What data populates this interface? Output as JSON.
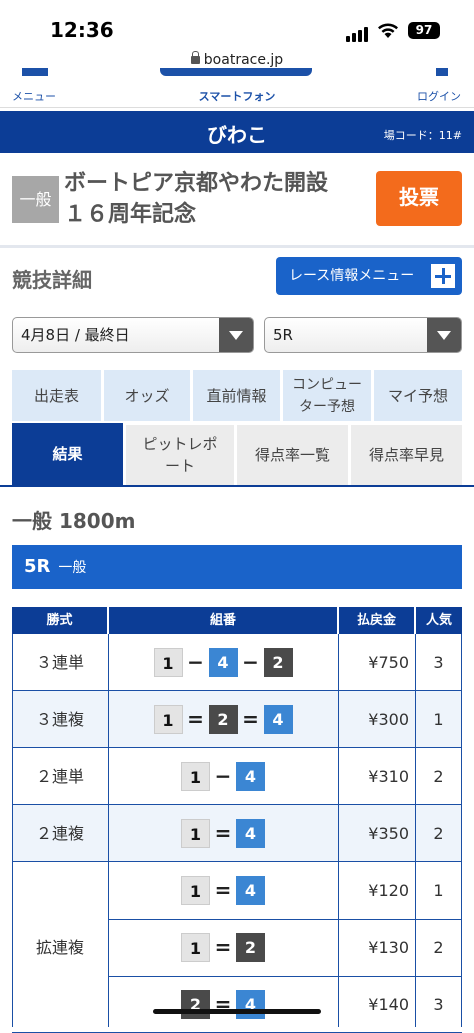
{
  "status_bar": {
    "time": "12:36",
    "battery": "97"
  },
  "browser": {
    "url": "boatrace.jp"
  },
  "nav": {
    "menu": "メニュー",
    "center": "スマートフォン",
    "login": "ログイン"
  },
  "venue": {
    "name": "びわこ",
    "code": "場コード：11#"
  },
  "race_header": {
    "grade": "一般",
    "title_line1": "ボートピア京都やわた開設",
    "title_line2": "１６周年記念",
    "vote_button": "投票"
  },
  "section": {
    "title": "競技詳細",
    "menu_button": "レース情報メニュー"
  },
  "selects": {
    "date": "4月8日 / 最終日",
    "race": "5R"
  },
  "tabs_row1": [
    {
      "label": "出走表"
    },
    {
      "label": "オッズ"
    },
    {
      "label": "直前情報"
    },
    {
      "label": "コンピュー\nター予想"
    },
    {
      "label": "マイ予想"
    }
  ],
  "tabs_row2": [
    {
      "label": "結果"
    },
    {
      "label": "ピットレポ\nート"
    },
    {
      "label": "得点率一覧"
    },
    {
      "label": "得点率早見"
    }
  ],
  "distance": "一般 1800m",
  "race_bar": {
    "race": "5R",
    "grade": "一般"
  },
  "payout_table": {
    "headers": {
      "kind": "勝式",
      "combo": "組番",
      "payout": "払戻金",
      "popularity": "人気"
    },
    "rows": [
      {
        "kind": "３連単",
        "combo": [
          "1",
          "−",
          "4",
          "−",
          "2"
        ],
        "payout": "¥750",
        "popularity": "3"
      },
      {
        "kind": "３連複",
        "combo": [
          "1",
          "=",
          "2",
          "=",
          "4"
        ],
        "payout": "¥300",
        "popularity": "1"
      },
      {
        "kind": "２連単",
        "combo": [
          "1",
          "−",
          "4"
        ],
        "payout": "¥310",
        "popularity": "2"
      },
      {
        "kind": "２連複",
        "combo": [
          "1",
          "=",
          "4"
        ],
        "payout": "¥350",
        "popularity": "2"
      },
      {
        "kind": "拡連複",
        "combo": [
          "1",
          "=",
          "4"
        ],
        "payout": "¥120",
        "popularity": "1"
      },
      {
        "kind": "",
        "combo": [
          "1",
          "=",
          "2"
        ],
        "payout": "¥130",
        "popularity": "2"
      },
      {
        "kind": "",
        "combo": [
          "2",
          "=",
          "4"
        ],
        "payout": "¥140",
        "popularity": "3"
      }
    ]
  }
}
